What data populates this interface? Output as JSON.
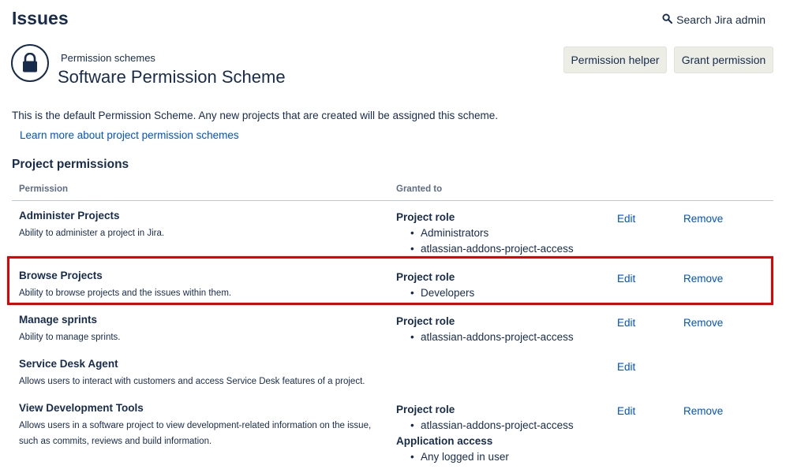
{
  "header": {
    "page_title": "Issues",
    "search_label": "Search Jira admin",
    "search_icon": "search-icon"
  },
  "scheme": {
    "icon": "lock-icon",
    "breadcrumb": "Permission schemes",
    "title": "Software Permission Scheme",
    "buttons": {
      "helper": "Permission helper",
      "grant": "Grant permission"
    },
    "description": "This is the default Permission Scheme. Any new projects that are created will be assigned this scheme.",
    "learn_more": "Learn more about project permission schemes"
  },
  "permissions_section": {
    "title": "Project permissions",
    "columns": {
      "permission": "Permission",
      "granted_to": "Granted to"
    },
    "rows": [
      {
        "name": "Administer Projects",
        "description": "Ability to administer a project in Jira.",
        "grants": [
          {
            "type": "Project role",
            "values": [
              "Administrators",
              "atlassian-addons-project-access"
            ]
          }
        ],
        "edit": "Edit",
        "remove": "Remove"
      },
      {
        "name": "Browse Projects",
        "description": "Ability to browse projects and the issues within them.",
        "grants": [
          {
            "type": "Project role",
            "values": [
              "Developers"
            ]
          }
        ],
        "edit": "Edit",
        "remove": "Remove",
        "highlighted": true
      },
      {
        "name": "Manage sprints",
        "description": "Ability to manage sprints.",
        "grants": [
          {
            "type": "Project role",
            "values": [
              "atlassian-addons-project-access"
            ]
          }
        ],
        "edit": "Edit",
        "remove": "Remove"
      },
      {
        "name": "Service Desk Agent",
        "description": "Allows users to interact with customers and access Service Desk features of a project.",
        "grants": [],
        "edit": "Edit"
      },
      {
        "name": "View Development Tools",
        "description": "Allows users in a software project to view development-related information on the issue, such as commits, reviews and build information.",
        "grants": [
          {
            "type": "Project role",
            "values": [
              "atlassian-addons-project-access"
            ]
          },
          {
            "type": "Application access",
            "values": [
              "Any logged in user"
            ]
          }
        ],
        "edit": "Edit",
        "remove": "Remove"
      }
    ]
  },
  "colors": {
    "text": "#172b4d",
    "link": "#0052cc",
    "highlight_border": "#e80000",
    "button_bg": "#eceee6"
  }
}
